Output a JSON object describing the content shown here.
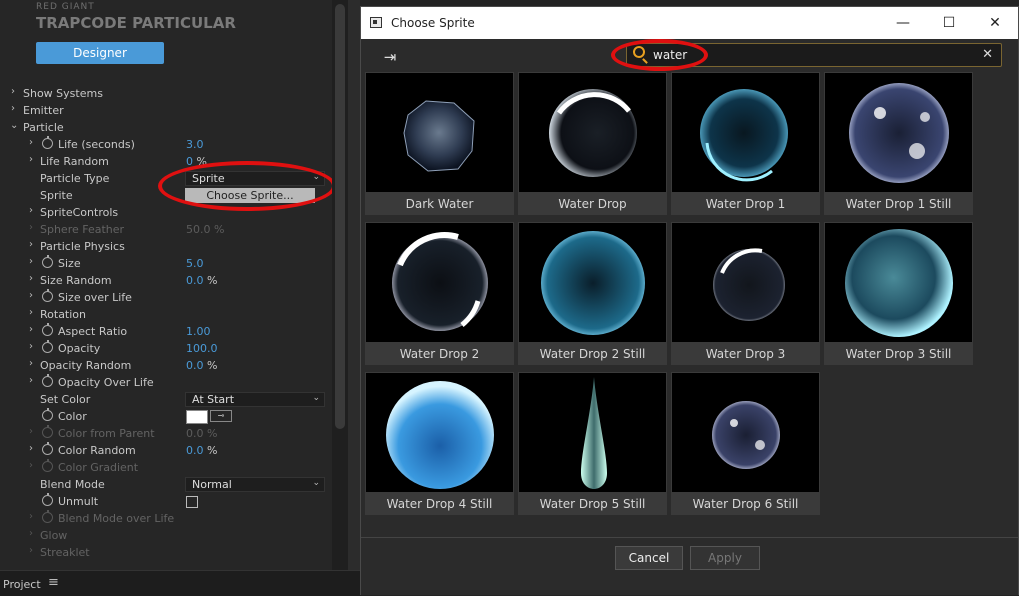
{
  "effect": {
    "brand_top": "RED GIANT",
    "brand": "TRAPCODE PARTICULAR",
    "designer_label": "Designer",
    "rows": [
      {
        "label": "Show Systems"
      },
      {
        "label": "Emitter"
      },
      {
        "label": "Particle"
      },
      {
        "label": "Life (seconds)",
        "value": "3.0"
      },
      {
        "label": "Life Random",
        "value": "0",
        "unit": "%"
      },
      {
        "label": "Particle Type",
        "value": "Sprite"
      },
      {
        "label": "Sprite",
        "value": "Choose Sprite..."
      },
      {
        "label": "SpriteControls"
      },
      {
        "label": "Sphere Feather",
        "value": "50.0",
        "unit": "%"
      },
      {
        "label": "Particle Physics"
      },
      {
        "label": "Size",
        "value": "5.0"
      },
      {
        "label": "Size Random",
        "value": "0.0",
        "unit": "%"
      },
      {
        "label": "Size over Life"
      },
      {
        "label": "Rotation"
      },
      {
        "label": "Aspect Ratio",
        "value": "1.00"
      },
      {
        "label": "Opacity",
        "value": "100.0"
      },
      {
        "label": "Opacity Random",
        "value": "0.0",
        "unit": "%"
      },
      {
        "label": "Opacity Over Life"
      },
      {
        "label": "Set Color",
        "value": "At Start"
      },
      {
        "label": "Color"
      },
      {
        "label": "Color from Parent",
        "value": "0.0",
        "unit": "%"
      },
      {
        "label": "Color Random",
        "value": "0.0",
        "unit": "%"
      },
      {
        "label": "Color Gradient"
      },
      {
        "label": "Blend Mode",
        "value": "Normal"
      },
      {
        "label": "Unmult"
      },
      {
        "label": "Blend Mode over Life"
      },
      {
        "label": "Glow"
      },
      {
        "label": "Streaklet"
      }
    ]
  },
  "bottom": {
    "project_label": "Project"
  },
  "dialog": {
    "title": "Choose Sprite",
    "search_value": "water",
    "sprites": [
      "Dark Water",
      "Water Drop",
      "Water Drop 1",
      "Water Drop 1 Still",
      "Water Drop 2",
      "Water Drop 2 Still",
      "Water Drop 3",
      "Water Drop 3 Still",
      "Water Drop 4 Still",
      "Water Drop 5 Still",
      "Water Drop 6 Still"
    ],
    "cancel_label": "Cancel",
    "apply_label": "Apply"
  },
  "colors": {
    "accent_blue": "#4a9ad8",
    "highlight_red": "#e01010",
    "search_icon": "#e8a020"
  }
}
